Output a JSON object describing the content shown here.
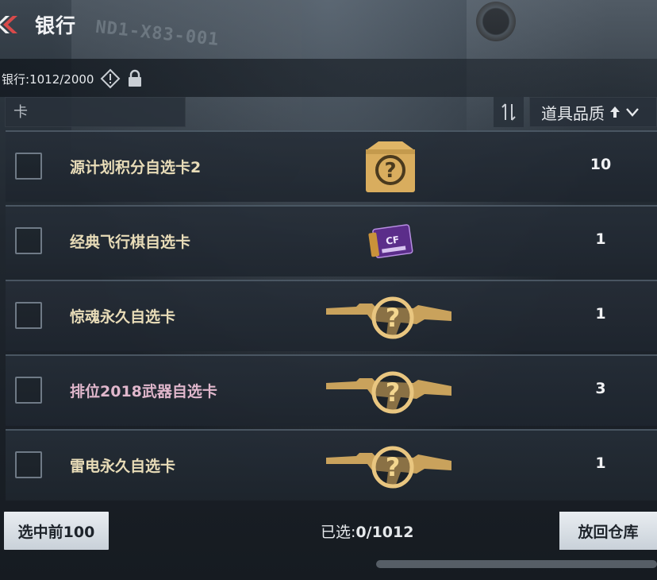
{
  "header": {
    "title": "银行",
    "back_icon": "back-chevron-icon"
  },
  "bank": {
    "label": "银行:",
    "count": "1012/2000"
  },
  "search": {
    "placeholder": "卡"
  },
  "sort": {
    "label": "道具品质"
  },
  "items": [
    {
      "name": "源计划积分自选卡2",
      "qty": "10",
      "icon": "mystery-crate-icon",
      "name_color": "#e8dcb8"
    },
    {
      "name": "经典飞行棋自选卡",
      "qty": "1",
      "icon": "purple-ticket-icon",
      "name_color": "#e8dcb8"
    },
    {
      "name": "惊魂永久自选卡",
      "qty": "1",
      "icon": "rifle-mystery-icon",
      "name_color": "#e8dcb8"
    },
    {
      "name": "排位2018武器自选卡",
      "qty": "3",
      "icon": "rifle-mystery-icon",
      "name_color": "#e0b7cc"
    },
    {
      "name": "雷电永久自选卡",
      "qty": "1",
      "icon": "rifle-mystery-icon",
      "name_color": "#e8dcb8"
    }
  ],
  "footer": {
    "select_top_label": "选中前100",
    "selected_label": "已选:",
    "selected_value": "0/1012",
    "return_label": "放回仓库"
  }
}
